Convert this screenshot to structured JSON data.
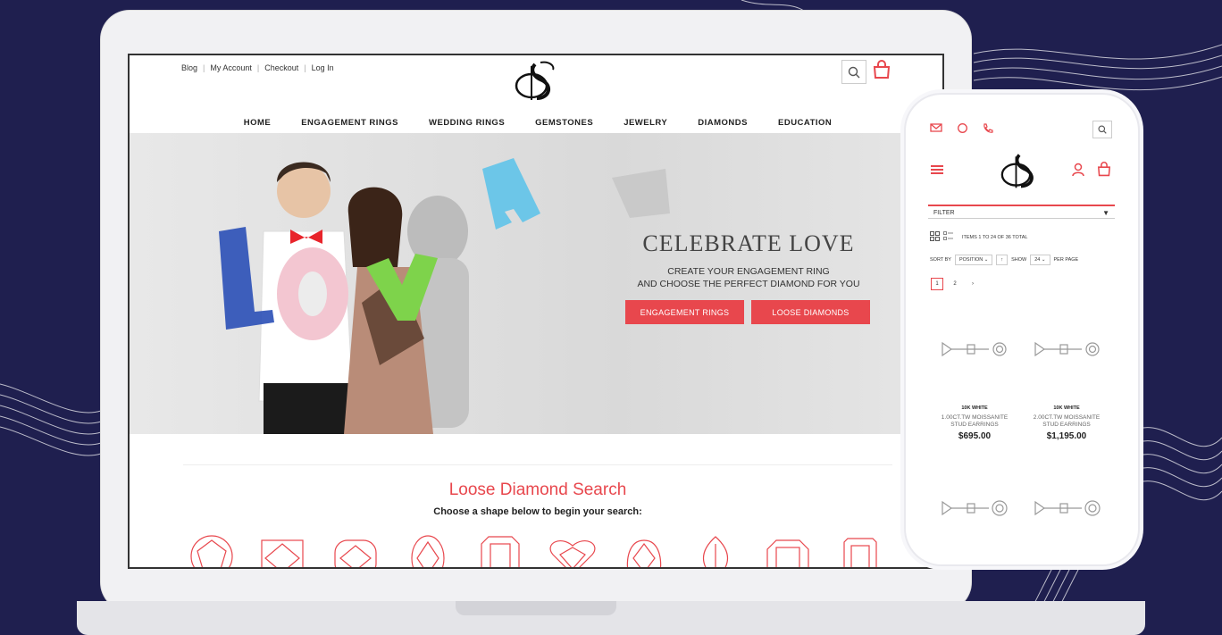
{
  "desktop": {
    "top_links": [
      "Blog",
      "My Account",
      "Checkout",
      "Log In"
    ],
    "logo_text": "DS",
    "nav": [
      "HOME",
      "ENGAGEMENT RINGS",
      "WEDDING RINGS",
      "GEMSTONES",
      "JEWELRY",
      "DIAMONDS",
      "EDUCATION"
    ],
    "hero": {
      "title": "CELEBRATE LOVE",
      "subtitle_line1": "CREATE YOUR ENGAGEMENT RING",
      "subtitle_line2": "AND CHOOSE THE PERFECT DIAMOND FOR YOU",
      "button1": "ENGAGEMENT RINGS",
      "button2": "LOOSE DIAMONDS"
    },
    "diamond_search": {
      "title": "Loose Diamond Search",
      "subtitle": "Choose a shape below to begin your search:"
    }
  },
  "mobile": {
    "logo_text": "DS",
    "filter_label": "FILTER",
    "items_text": "ITEMS 1 TO 24 OF 36 TOTAL",
    "sort_label": "SORT BY",
    "sort_value": "POSITION",
    "show_label": "SHOW",
    "show_value": "24",
    "per_page_label": "PER PAGE",
    "pages": [
      "1",
      "2",
      "›"
    ],
    "products": [
      {
        "metal": "10K WHITE",
        "name_line1": "1.00CT.TW MOISSANITE",
        "name_line2": "STUD EARRINGS",
        "price": "$695.00"
      },
      {
        "metal": "10K WHITE",
        "name_line1": "2.00CT.TW MOISSANITE",
        "name_line2": "STUD EARRINGS",
        "price": "$1,195.00"
      }
    ]
  },
  "colors": {
    "accent": "#e8474d",
    "background": "#1f1f4f"
  }
}
